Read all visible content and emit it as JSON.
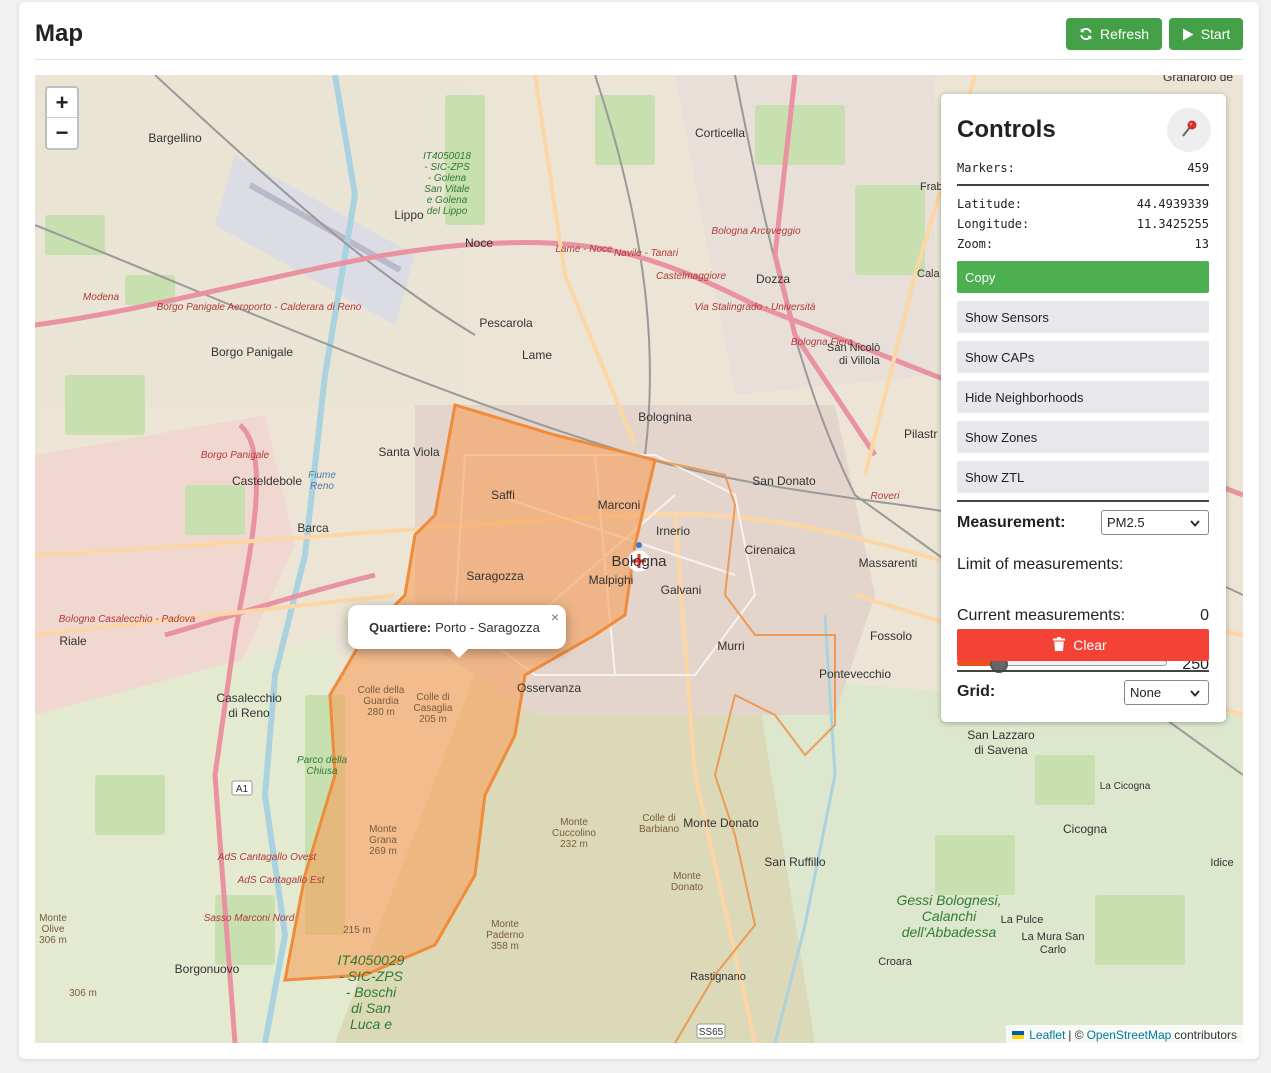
{
  "header": {
    "title": "Map",
    "refresh_label": "Refresh",
    "start_label": "Start"
  },
  "map": {
    "zoom_in": "+",
    "zoom_out": "−",
    "labels": {
      "bargellino": "Bargellino",
      "corticella": "Corticella",
      "lippo": "Lippo",
      "noce": "Noce",
      "pescarola": "Pescarola",
      "lame": "Lame",
      "borgo_panigale": "Borgo Panigale",
      "bolognina": "Bolognina",
      "santa_viola": "Santa Viola",
      "casteldebole": "Casteldebole",
      "barca": "Barca",
      "saffi": "Saffi",
      "marconi": "Marconi",
      "irnerio": "Irnerio",
      "bologna": "Bologna",
      "saragozza": "Saragozza",
      "malpighi": "Malpighi",
      "galvani": "Galvani",
      "san_donato": "San Donato",
      "cirenaica": "Cirenaica",
      "massarenti": "Massarenti",
      "riale": "Riale",
      "casalecchio": "Casalecchio\ndi Reno",
      "osservanza": "Osservanza",
      "murri": "Murri",
      "fossolo": "Fossolo",
      "pontevecchio": "Pontevecchio",
      "san_lazzaro": "San Lazzaro\ndi Savena",
      "monte_donato": "Monte Donato",
      "san_ruffillo": "San Ruffillo",
      "cicogna": "Cicogna",
      "la_cicogna": "La Cicogna",
      "idice": "Idice",
      "gessi": "Gessi Bolognesi,\nCalanchi\ndell'Abbadessa",
      "la_pulce": "La Pulce",
      "la_mura": "La Mura San\nCarlo",
      "croara": "Croara",
      "borgonuovo": "Borgonuovo",
      "rastignano": "Rastignano",
      "dozza": "Dozza",
      "colle_guardia": "Colle della\nGuardia\n280 m",
      "colle_casaglia": "Colle di\nCasaglia\n205 m",
      "monte_grana": "Monte\nGrana\n269 m",
      "monte_cuccolino": "Monte\nCuccolino\n232 m",
      "colle_barbiano": "Colle di\nBarbiano",
      "monte_paderno": "Monte\nPaderno\n358 m",
      "monte_olive": "Monte\nOlive\n306 m",
      "m306": "306 m",
      "m215": "215 m",
      "boschi": "IT4050029\n- SIC-ZPS\n- Boschi\ndi San\nLuca e",
      "sic_golena": "IT4050018\n- SIC-ZPS\n- Golena\nSan Vitale\ne Golena\ndel Lippo",
      "parco_chiusa": "Parco della\nChiusa",
      "granarolo": "Granarolo de",
      "a1": "A1",
      "ss65": "SS65",
      "pilastro": "Pilastr",
      "frab": "Frab",
      "cala": "Cala",
      "san_nicolo": "San Nicolò\ndi Villola",
      "bologna_fiera": "Bologna Fiera",
      "bologna_arcoveggio": "Bologna Arcoveggio",
      "castelmaggiore": "Castelmaggiore",
      "via_stalingrado": "Via Stalingrado - Università",
      "lame_noce": "Lame - Noce",
      "navile": "Navile - Tanari",
      "aeroporto": "Borgo Panigale   Aeroporto - Calderara di Reno",
      "modena": "Modena",
      "borgo_panigale_rail": "Borgo Panigale",
      "casalecchio_padova": "Bologna Casalecchio - Padova",
      "cantagallo_ovest": "AdS Cantagallo Ovest",
      "cantagallo_est": "AdS Cantagallo Est",
      "sasso_marconi": "Sasso Marconi Nord",
      "fiume_reno": "Fiume\nReno",
      "roveri": "Roveri"
    },
    "popup": {
      "key": "Quartiere:",
      "value": "Porto - Saragozza",
      "close": "×"
    },
    "attribution": {
      "leaflet": "Leaflet",
      "separator": "| ©",
      "osm": "OpenStreetMap",
      "suffix": "contributors"
    },
    "colors": {
      "neighborhood_fill": "#f6a05a",
      "neighborhood_stroke": "#f08b3a",
      "motorway": "#e892a2",
      "primary": "#fcd6a4"
    }
  },
  "controls": {
    "title": "Controls",
    "markers_label": "Markers:",
    "markers_value": "459",
    "latitude_label": "Latitude:",
    "latitude_value": "44.4939339",
    "longitude_label": "Longitude:",
    "longitude_value": "11.3425255",
    "zoom_label": "Zoom:",
    "zoom_value": "13",
    "copy_label": "Copy",
    "show_sensors": "Show Sensors",
    "show_caps": "Show CAPs",
    "hide_neighborhoods": "Hide Neighborhoods",
    "show_zones": "Show Zones",
    "show_ztl": "Show ZTL",
    "measurement_label": "Measurement:",
    "measurement_value": "PM2.5",
    "limit_label": "Limit of measurements:",
    "limit_value": "250",
    "limit_fraction": 0.2,
    "current_label": "Current measurements:",
    "current_value": "0",
    "clear_label": "Clear",
    "grid_label": "Grid:",
    "grid_value": "None"
  }
}
